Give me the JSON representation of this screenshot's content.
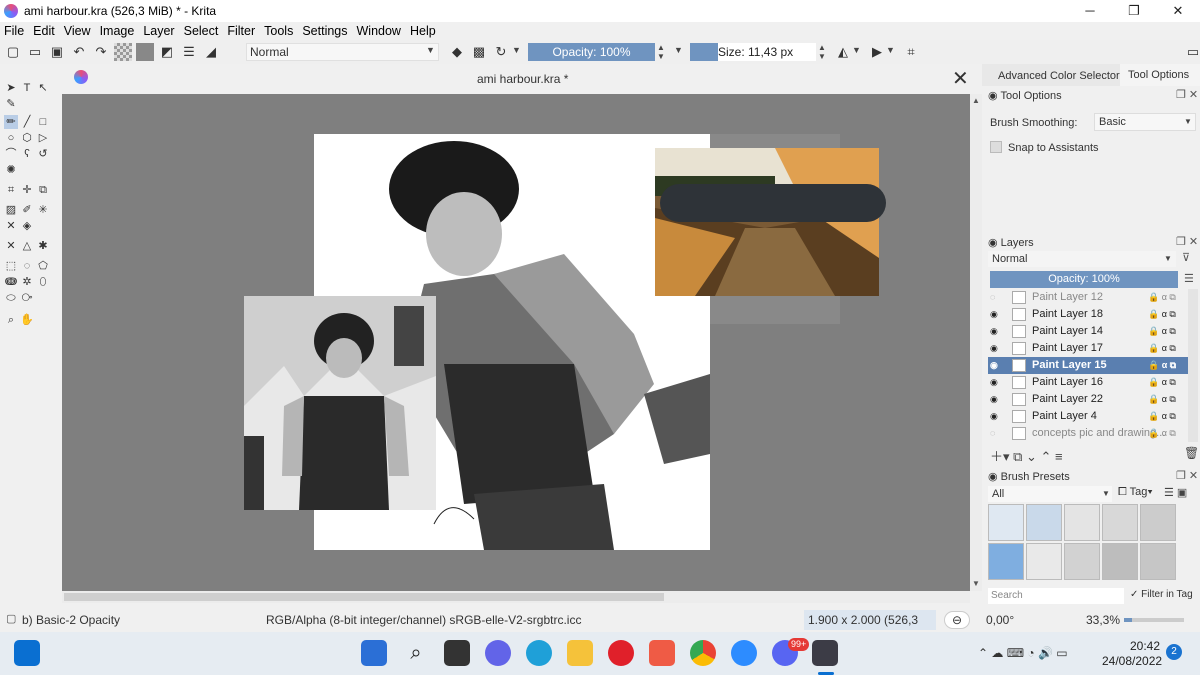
{
  "window": {
    "title": "ami harbour.kra (526,3 MiB)  * - Krita",
    "minimize": "─",
    "maximize": "❐",
    "close": "✕"
  },
  "menu": [
    "File",
    "Edit",
    "View",
    "Image",
    "Layer",
    "Select",
    "Filter",
    "Tools",
    "Settings",
    "Window",
    "Help"
  ],
  "toolbar": {
    "blend_mode": "Normal",
    "opacity": "Opacity: 100%",
    "opacity_fraction": 1.0,
    "size": "Size: 11,43 px",
    "size_fraction": 0.22
  },
  "document": {
    "tab_title": "ami harbour.kra *",
    "close": "✕"
  },
  "dock": {
    "tabs": [
      "Advanced Color Selector",
      "Tool Options"
    ],
    "tool_options": {
      "title": "Tool Options",
      "smoothing_label": "Brush Smoothing:",
      "smoothing_value": "Basic",
      "snap_label": "Snap to Assistants"
    },
    "layers": {
      "title": "Layers",
      "blend": "Normal",
      "opacity": "Opacity:  100%",
      "items": [
        {
          "name": "Paint Layer 12",
          "selected": false,
          "faded": true
        },
        {
          "name": "Paint Layer 18",
          "selected": false,
          "faded": false
        },
        {
          "name": "Paint Layer 14",
          "selected": false,
          "faded": false
        },
        {
          "name": "Paint Layer 17",
          "selected": false,
          "faded": false
        },
        {
          "name": "Paint Layer 15",
          "selected": true,
          "faded": false
        },
        {
          "name": "Paint Layer 16",
          "selected": false,
          "faded": false
        },
        {
          "name": "Paint Layer 22",
          "selected": false,
          "faded": false
        },
        {
          "name": "Paint Layer 4",
          "selected": false,
          "faded": false
        },
        {
          "name": "concepts pic and drawing...",
          "selected": false,
          "faded": true
        }
      ]
    },
    "brush_presets": {
      "title": "Brush Presets",
      "filter": "All",
      "tag": "Tag",
      "search_placeholder": "Search",
      "filter_in_tag": "Filter in Tag"
    }
  },
  "status": {
    "brush": "b) Basic-2 Opacity",
    "color_space": "RGB/Alpha (8-bit integer/channel)  sRGB-elle-V2-srgbtrc.icc",
    "dimensions": "1.900 x 2.000 (526,3 MiB)",
    "rotation": "0,00°",
    "zoom": "33,3%"
  },
  "taskbar": {
    "time": "20:42",
    "date": "24/08/2022",
    "notifications": "2",
    "discord_badge": "99+"
  },
  "colors": {
    "accent": "#6f94c0",
    "selection": "#5a7fb0",
    "canvas_bg": "#7f7f7f"
  }
}
